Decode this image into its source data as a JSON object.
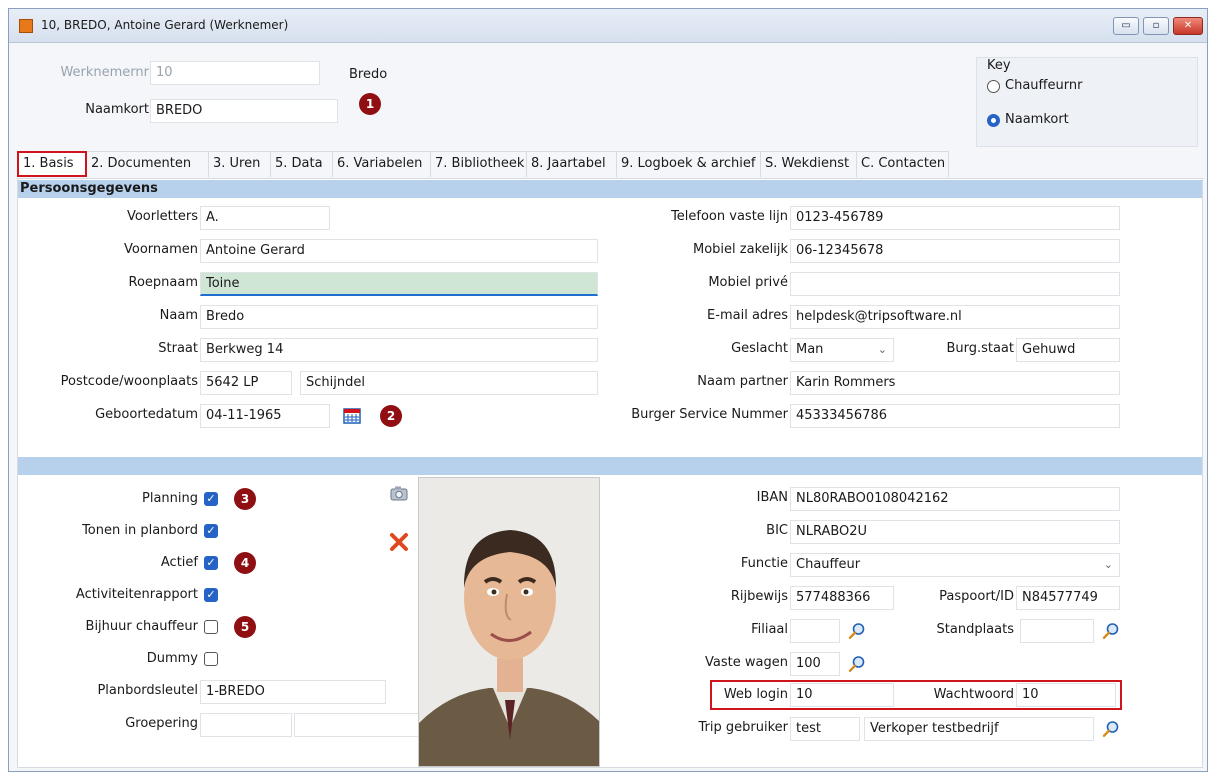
{
  "window": {
    "title": "10, BREDO, Antoine Gerard (Werknemer)",
    "min": "▭",
    "max": "▫",
    "close": "✕"
  },
  "header": {
    "werknemernr_label": "Werknemernr",
    "werknemernr_value": "10",
    "naamkort_label": "Naamkort",
    "naamkort_value": "BREDO",
    "name_display": "Bredo"
  },
  "key": {
    "title": "Key",
    "options": [
      {
        "label": "Chauffeurnr",
        "selected": false
      },
      {
        "label": "Naamkort",
        "selected": true
      }
    ]
  },
  "badges": [
    "1",
    "2",
    "3",
    "4",
    "5"
  ],
  "tabs": [
    "1. Basis",
    "2. Documenten",
    "3. Uren",
    "5. Data",
    "6. Variabelen",
    "7. Bibliotheek",
    "8. Jaartabel",
    "9. Logboek & archief",
    "S. Wekdienst",
    "C. Contacten"
  ],
  "section1": {
    "title": "Persoonsgegevens",
    "voorletters": {
      "label": "Voorletters",
      "value": "A."
    },
    "voornamen": {
      "label": "Voornamen",
      "value": "Antoine Gerard"
    },
    "roepnaam": {
      "label": "Roepnaam",
      "value": "Toine"
    },
    "naam": {
      "label": "Naam",
      "value": "Bredo"
    },
    "straat": {
      "label": "Straat",
      "value": "Berkweg 14"
    },
    "postcode": {
      "label": "Postcode/woonplaats",
      "value": "5642 LP",
      "plaats": "Schijndel"
    },
    "geboortedatum": {
      "label": "Geboortedatum",
      "value": "04-11-1965"
    },
    "telefoon": {
      "label": "Telefoon vaste lijn",
      "value": "0123-456789"
    },
    "mobiel_zakelijk": {
      "label": "Mobiel zakelijk",
      "value": "06-12345678"
    },
    "mobiel_prive": {
      "label": "Mobiel privé",
      "value": ""
    },
    "email": {
      "label": "E-mail adres",
      "value": "helpdesk@tripsoftware.nl"
    },
    "geslacht": {
      "label": "Geslacht",
      "value": "Man"
    },
    "burgstaat": {
      "label": "Burg.staat",
      "value": "Gehuwd"
    },
    "partner": {
      "label": "Naam partner",
      "value": "Karin Rommers"
    },
    "bsn": {
      "label": "Burger Service Nummer",
      "value": "45333456786"
    }
  },
  "section2": {
    "planning": {
      "label": "Planning",
      "checked": true
    },
    "tonen": {
      "label": "Tonen in planbord",
      "checked": true
    },
    "actief": {
      "label": "Actief",
      "checked": true
    },
    "activiteiten": {
      "label": "Activiteitenrapport",
      "checked": true
    },
    "bijhuur": {
      "label": "Bijhuur chauffeur",
      "checked": false
    },
    "dummy": {
      "label": "Dummy",
      "checked": false
    },
    "planbordsleutel": {
      "label": "Planbordsleutel",
      "value": "1-BREDO"
    },
    "groepering": {
      "label": "Groepering",
      "value1": "",
      "value2": ""
    },
    "iban": {
      "label": "IBAN",
      "value": "NL80RABO0108042162"
    },
    "bic": {
      "label": "BIC",
      "value": "NLRABO2U"
    },
    "functie": {
      "label": "Functie",
      "value": "Chauffeur"
    },
    "rijbewijs": {
      "label": "Rijbewijs",
      "value": "577488366"
    },
    "paspoort": {
      "label": "Paspoort/ID",
      "value": "N84577749"
    },
    "filiaal": {
      "label": "Filiaal",
      "value": ""
    },
    "standplaats": {
      "label": "Standplaats",
      "value": ""
    },
    "vaste_wagen": {
      "label": "Vaste wagen",
      "value": "100"
    },
    "weblogin": {
      "label": "Web login",
      "value": "10"
    },
    "wachtwoord": {
      "label": "Wachtwoord",
      "value": "10"
    },
    "tripgebruiker": {
      "label": "Trip gebruiker",
      "value": "test",
      "name": "Verkoper testbedrijf"
    }
  },
  "colors": {
    "badge": "#8f0f12",
    "highlight": "#d0141c",
    "section": "#b7d0ec",
    "active_field": "#cfe6d4"
  }
}
